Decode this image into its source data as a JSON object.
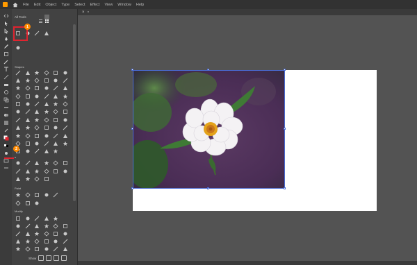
{
  "menubar": {
    "items": [
      "File",
      "Edit",
      "Object",
      "Type",
      "Select",
      "Effect",
      "View",
      "Window",
      "Help"
    ]
  },
  "panel": {
    "title": "All Tools",
    "sections": {
      "shapes": "Shapes",
      "section3": "s",
      "paint": "Paint",
      "modify": "Modify"
    },
    "bottom_label": "Show"
  },
  "badges": {
    "first": "1",
    "second": "2"
  },
  "colors": {
    "highlight": "#e0242f",
    "badge": "#ff8a00",
    "selection": "#4a6cd6"
  }
}
